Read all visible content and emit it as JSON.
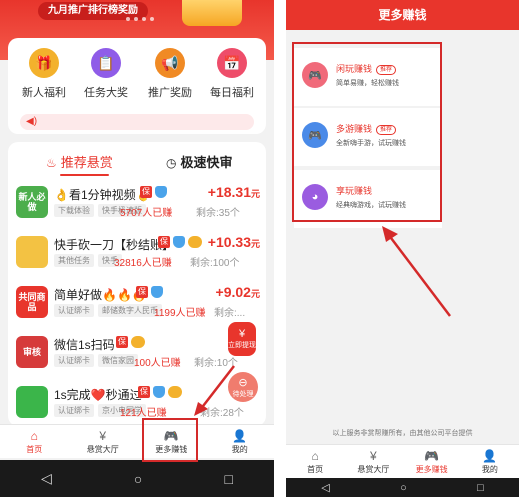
{
  "left": {
    "banner": {
      "pill_text": "九月推广排行榜奖励"
    },
    "quick_items": [
      {
        "label": "新人福利",
        "icon": "gift-icon",
        "color": "#f3b12c",
        "glyph": "🎁"
      },
      {
        "label": "任务大奖",
        "icon": "clipboard-icon",
        "color": "#8f5ce8",
        "glyph": "📋"
      },
      {
        "label": "推广奖励",
        "icon": "megaphone-icon",
        "color": "#f08a24",
        "glyph": "📢"
      },
      {
        "label": "每日福利",
        "icon": "calendar-icon",
        "color": "#ee4d6a",
        "glyph": "📅"
      }
    ],
    "tabs": {
      "active": "推荐悬赏",
      "other": "极速快审"
    },
    "tasks": [
      {
        "thumb_text": "新人必做",
        "thumb_color": "#4cae4c",
        "title": "👌看1分钟视频👌",
        "badge_set": "shield",
        "tags": [
          "下载体验",
          "快手极速版"
        ],
        "people": "5707人已赚",
        "remain": "剩余:35个",
        "price": "+18.31",
        "unit": "元"
      },
      {
        "thumb_text": "",
        "thumb_color": "#f3c243",
        "title": "快手砍一刀【秒结账】",
        "badge_set": "full",
        "tags": [
          "其他任务",
          "快手"
        ],
        "people": "32816人已赚",
        "remain": "剩余:100个",
        "price": "+10.33",
        "unit": "元"
      },
      {
        "thumb_text": "共同商品",
        "thumb_color": "#e8352c",
        "title": "简单好做🔥🔥🔥",
        "badge_set": "shield",
        "tags": [
          "认证绑卡",
          "邮储数字人民币"
        ],
        "people": "1199人已赚",
        "remain": "剩余:...",
        "price": "+9.02",
        "unit": "元"
      },
      {
        "thumb_text": "审核",
        "thumb_color": "#d63b3b",
        "title": "微信1s扫码",
        "badge_set": "gold",
        "tags": [
          "认证绑卡",
          "微信家园"
        ],
        "people": "100人已赚",
        "remain": "剩余:10个",
        "price": "",
        "unit": ""
      },
      {
        "thumb_text": "",
        "thumb_color": "#3bb54a",
        "title": "1s完成❤️秒通过",
        "badge_set": "full",
        "tags": [
          "认证绑卡",
          "京小电同学"
        ],
        "people": "121人已赚",
        "remain": "剩余:28个",
        "price": "",
        "unit": ""
      }
    ],
    "float_withdraw": {
      "glyph": "¥",
      "label": "立即提现"
    },
    "float_pending": {
      "glyph": "⊖",
      "label": "待处理"
    },
    "tabbar": [
      {
        "label": "首页",
        "icon": "home-icon",
        "glyph": "⌂",
        "active": true
      },
      {
        "label": "悬赏大厅",
        "icon": "bounty-hall-icon",
        "glyph": "¥",
        "active": false
      },
      {
        "label": "更多赚钱",
        "icon": "gamepad-icon",
        "glyph": "🎮",
        "active": false
      },
      {
        "label": "我的",
        "icon": "person-icon",
        "glyph": "👤",
        "active": false
      }
    ],
    "navbar": {
      "back": "◁",
      "home": "○",
      "recent": "□"
    }
  },
  "right": {
    "header": "更多赚钱",
    "games": [
      {
        "title": "闲玩赚钱",
        "hot": "推荐",
        "subtitle": "简单易赚，轻松赚钱",
        "icon": "gamepad-icon",
        "color": "#f06a7a",
        "glyph": "🎮"
      },
      {
        "title": "多游赚钱",
        "hot": "推荐",
        "subtitle": "全新嗨手游，试玩赚钱",
        "icon": "controller-icon",
        "color": "#4a8ae8",
        "glyph": "🎮"
      },
      {
        "title": "享玩赚钱",
        "hot": "",
        "subtitle": "经典嗨游戏，试玩赚钱",
        "icon": "pacman-icon",
        "color": "#9a5ce0",
        "glyph": "◕"
      }
    ],
    "footer": "以上服务非赏帮赚所有，由其他公司平台提供",
    "tabbar": [
      {
        "label": "首页",
        "icon": "home-icon",
        "glyph": "⌂",
        "active": false
      },
      {
        "label": "悬赏大厅",
        "icon": "bounty-hall-icon",
        "glyph": "¥",
        "active": false
      },
      {
        "label": "更多赚钱",
        "icon": "gamepad-icon",
        "glyph": "🎮",
        "active": true
      },
      {
        "label": "我的",
        "icon": "person-icon",
        "glyph": "👤",
        "active": false
      }
    ],
    "navbar": {
      "back": "◁",
      "home": "○",
      "recent": "□"
    }
  },
  "colors": {
    "accent": "#e8352c",
    "annotation": "#d42a2a"
  }
}
